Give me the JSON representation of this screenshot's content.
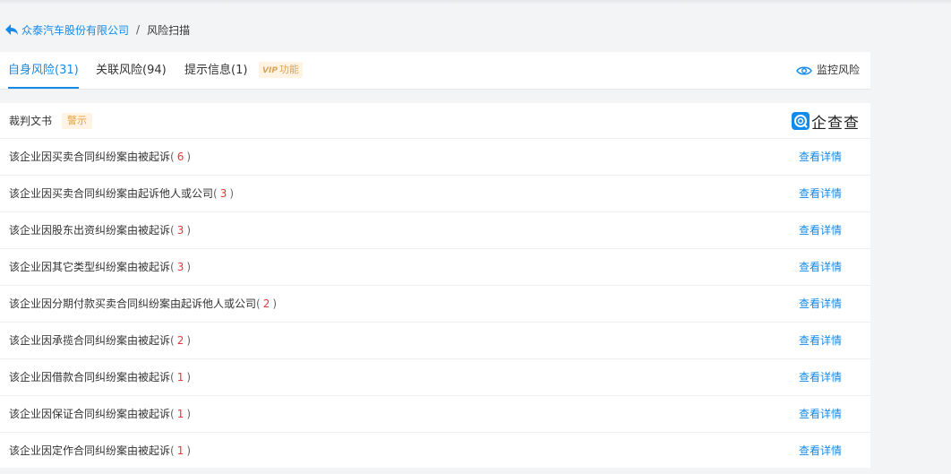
{
  "breadcrumb": {
    "company": "众泰汽车股份有限公司",
    "separator": "/",
    "current": "风险扫描"
  },
  "tabs": [
    {
      "label": "自身风险(31)",
      "active": true
    },
    {
      "label": "关联风险(94)",
      "active": false
    },
    {
      "label": "提示信息(1)",
      "active": false
    }
  ],
  "vip": {
    "mark": "VIP",
    "label": "功能"
  },
  "monitor": {
    "label": "监控风险",
    "icon": "eye-icon"
  },
  "section": {
    "title": "裁判文书",
    "badge": "警示",
    "logo_text": "企查查",
    "logo_icon": "qichacha-logo-icon"
  },
  "rows": [
    {
      "text": "该企业因买卖合同纠纷案由被起诉",
      "count": "6",
      "link": "查看详情"
    },
    {
      "text": "该企业因买卖合同纠纷案由起诉他人或公司",
      "count": "3",
      "link": "查看详情"
    },
    {
      "text": "该企业因股东出资纠纷案由被起诉",
      "count": "3",
      "link": "查看详情"
    },
    {
      "text": "该企业因其它类型纠纷案由被起诉",
      "count": "3",
      "link": "查看详情"
    },
    {
      "text": "该企业因分期付款买卖合同纠纷案由起诉他人或公司",
      "count": "2",
      "link": "查看详情"
    },
    {
      "text": "该企业因承揽合同纠纷案由被起诉",
      "count": "2",
      "link": "查看详情"
    },
    {
      "text": "该企业因借款合同纠纷案由被起诉",
      "count": "1",
      "link": "查看详情"
    },
    {
      "text": "该企业因保证合同纠纷案由被起诉",
      "count": "1",
      "link": "查看详情"
    },
    {
      "text": "该企业因定作合同纠纷案由被起诉",
      "count": "1",
      "link": "查看详情"
    }
  ],
  "colors": {
    "accent": "#128bed",
    "count": "#e4393c",
    "badge_bg": "#fff3e4",
    "badge_text": "#e6a23c"
  }
}
